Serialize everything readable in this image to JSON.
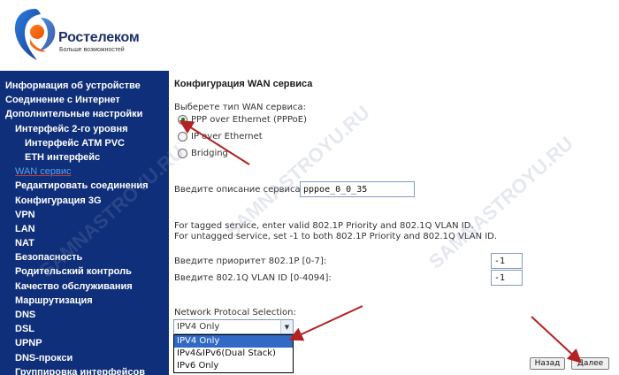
{
  "header": {
    "brand": "Ростелеком",
    "tagline": "Больше возможностей"
  },
  "sidebar": {
    "items": [
      {
        "label": "Информация об устройстве"
      },
      {
        "label": "Соединение с Интернет"
      },
      {
        "label": "Дополнительные настройки"
      },
      {
        "label": "Интерфейс 2-го уровня"
      },
      {
        "label": "Интерфейс ATM PVC"
      },
      {
        "label": "ETH интерфейс"
      },
      {
        "label": "WAN сервис"
      },
      {
        "label": "Редактировать соединения"
      },
      {
        "label": "Конфигурация 3G"
      },
      {
        "label": "VPN"
      },
      {
        "label": "LAN"
      },
      {
        "label": "NAT"
      },
      {
        "label": "Безопасность"
      },
      {
        "label": "Родительский контроль"
      },
      {
        "label": "Качество обслуживания"
      },
      {
        "label": "Маршрутизация"
      },
      {
        "label": "DNS"
      },
      {
        "label": "DSL"
      },
      {
        "label": "UPNP"
      },
      {
        "label": "DNS-прокси"
      },
      {
        "label": "Группировка интерфейсов"
      }
    ]
  },
  "main": {
    "title": "Конфигурация WAN сервиса",
    "choose_label": "Выберете тип WAN сервиса:",
    "radios": [
      {
        "label": "PPP over Ethernet (PPPoE)",
        "checked": true
      },
      {
        "label": "IP over Ethernet",
        "checked": false
      },
      {
        "label": "Bridging",
        "checked": false
      }
    ],
    "description_label": "Введите описание сервиса:",
    "description_value": "pppoe_0_0_35",
    "vlan_note_1": "For tagged service, enter valid 802.1P Priority and 802.1Q VLAN ID.",
    "vlan_note_2": "For untagged service, set -1 to both 802.1P Priority and 802.1Q VLAN ID.",
    "priority_label": "Введите приоритет 802.1P [0-7]:",
    "priority_value": "-1",
    "vlan_label": "Введите 802.1Q VLAN ID [0-4094]:",
    "vlan_value": "-1",
    "protocol_label": "Network Protocal Selection:",
    "protocol_selected": "IPV4 Only",
    "protocol_options": [
      "IPV4 Only",
      "IPv4&IPv6(Dual Stack)",
      "IPv6 Only"
    ],
    "back_button": "Назад",
    "next_button": "Далее"
  },
  "watermarks": [
    "SAMNASTROYU.RU",
    "SAMNASTROYU.RU",
    "SAMNASTROYU.RU"
  ],
  "colors": {
    "sidebar_bg": "#0f2f7a",
    "active_link": "#5aa0e6",
    "arrow": "#b22222",
    "selected_option": "#316ac5"
  }
}
